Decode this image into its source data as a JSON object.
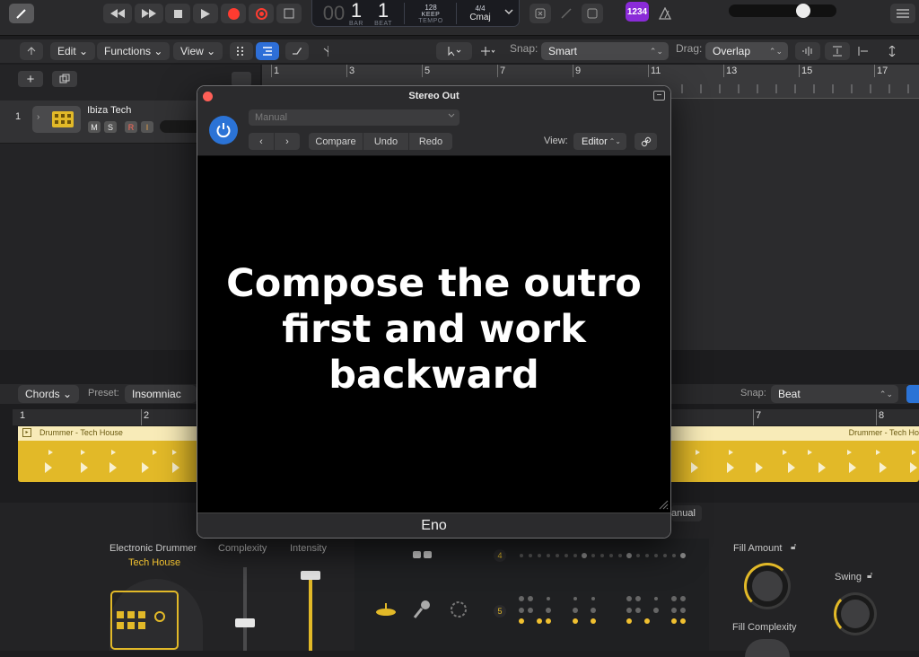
{
  "transport": {
    "bar": "1",
    "beat": "1",
    "bar_label": "BAR",
    "beat_label": "BEAT",
    "tempo_value": "128",
    "tempo_mode": "KEEP",
    "tempo_label": "TEMPO",
    "time_signature": "4/4",
    "key": "Cmaj",
    "count_in": "1234"
  },
  "toolbar": {
    "edit": "Edit",
    "functions": "Functions",
    "view": "View",
    "snap_label": "Snap:",
    "snap_value": "Smart",
    "drag_label": "Drag:",
    "drag_value": "Overlap"
  },
  "ruler": [
    "1",
    "3",
    "5",
    "7",
    "9",
    "11",
    "13",
    "15",
    "17"
  ],
  "track": {
    "number": "1",
    "name": "Ibiza Tech",
    "mute": "M",
    "solo": "S",
    "record": "R",
    "input": "I"
  },
  "editor": {
    "mode": "Chords",
    "preset_label": "Preset:",
    "preset_value": "Insomniac",
    "snap_label": "Snap:",
    "snap_value": "Beat",
    "ruler": [
      "1",
      "2",
      "7",
      "8"
    ],
    "region_name": "Drummer - Tech House",
    "region_name_right": "Drummer - Tech Ho",
    "manual_partial": "anual"
  },
  "drummer": {
    "title": "Electronic Drummer",
    "style": "Tech House",
    "complexity_label": "Complexity",
    "intensity_label": "Intensity",
    "fill_amount_label": "Fill Amount",
    "fill_complexity_label": "Fill Complexity",
    "swing_label": "Swing",
    "row_4": "4",
    "row_5": "5"
  },
  "plugin": {
    "title": "Stereo Out",
    "preset": "Manual",
    "compare": "Compare",
    "undo": "Undo",
    "redo": "Redo",
    "view_label": "View:",
    "view_value": "Editor",
    "message": "Compose the outro first and work backward",
    "footer": "Eno"
  },
  "colors": {
    "accent_blue": "#2b73d6",
    "record_red": "#ff3b30",
    "region_yellow": "#e2b928",
    "count_in_purple": "#8a2bd8"
  }
}
